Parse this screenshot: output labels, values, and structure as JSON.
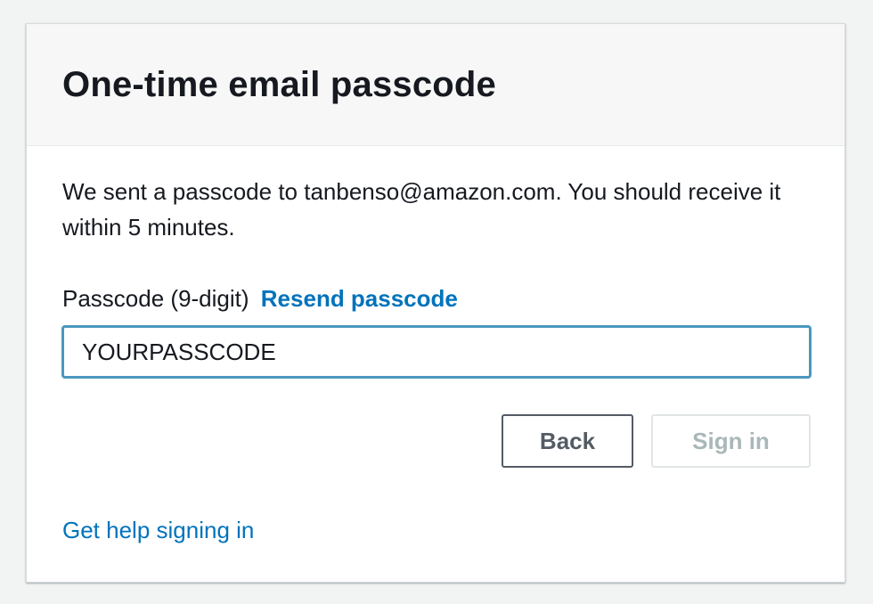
{
  "header": {
    "title": "One-time email passcode"
  },
  "message": {
    "text": "We sent a passcode to tanbenso@amazon.com. You should receive it within 5 minutes."
  },
  "passcode": {
    "label": "Passcode (9-digit)",
    "resend_label": "Resend passcode",
    "value": "YOURPASSCODE"
  },
  "actions": {
    "back_label": "Back",
    "signin_label": "Sign in",
    "signin_disabled": true
  },
  "footer": {
    "help_label": "Get help signing in"
  },
  "colors": {
    "link": "#0073bb",
    "input_focus_border": "#4a98be",
    "disabled_text": "#aab7b8"
  }
}
